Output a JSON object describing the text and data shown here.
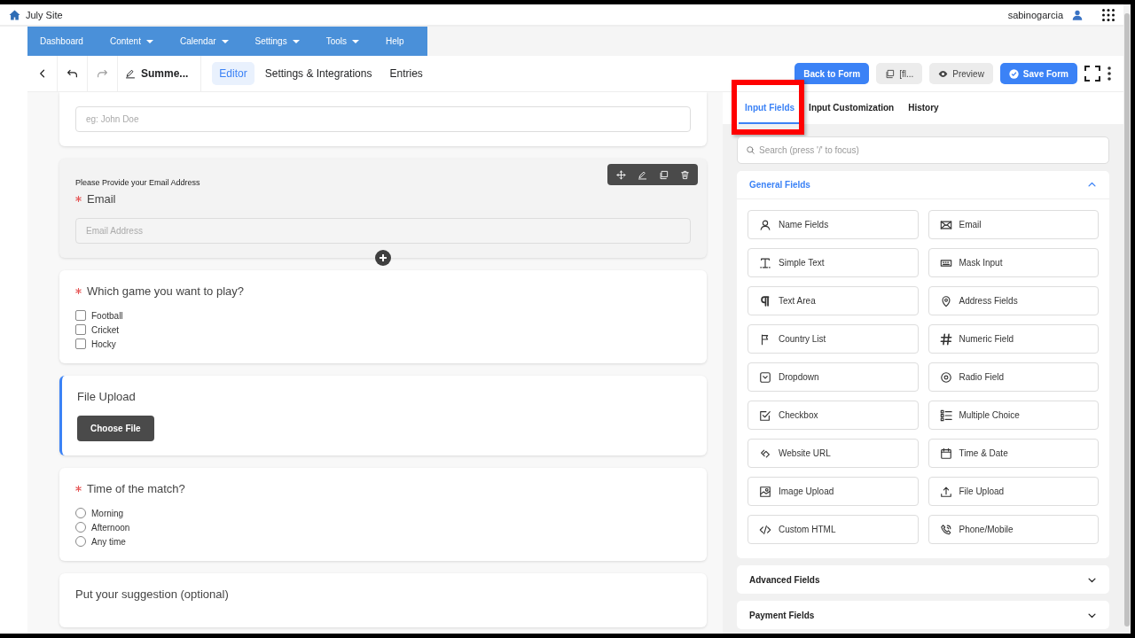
{
  "site": {
    "title": "July Site",
    "user": "sabinogarcia"
  },
  "nav": [
    {
      "label": "Dashboard",
      "dropdown": false
    },
    {
      "label": "Content",
      "dropdown": true
    },
    {
      "label": "Calendar",
      "dropdown": true
    },
    {
      "label": "Settings",
      "dropdown": true
    },
    {
      "label": "Tools",
      "dropdown": true
    },
    {
      "label": "Help",
      "dropdown": false
    }
  ],
  "toolbar": {
    "form_name": "Summe...",
    "tabs": [
      {
        "label": "Editor",
        "selected": true
      },
      {
        "label": "Settings & Integrations",
        "selected": false
      },
      {
        "label": "Entries",
        "selected": false
      }
    ],
    "buttons": [
      {
        "label": "Back to Form",
        "kind": "primary"
      },
      {
        "label": "[fl...",
        "kind": "shortcode"
      },
      {
        "label": "Preview",
        "kind": "preview"
      },
      {
        "label": "Save Form",
        "kind": "save"
      }
    ]
  },
  "form_fields": [
    {
      "kind": "text",
      "placeholder": "eg: John Doe",
      "selected": false,
      "focused": false
    },
    {
      "kind": "email",
      "help_text": "Please Provide your Email Address",
      "label": "Email",
      "required": true,
      "placeholder": "Email Address",
      "selected": true,
      "focused": false
    },
    {
      "kind": "checkbox",
      "label": "Which game you want to play?",
      "required": true,
      "selected": false,
      "focused": false,
      "options": [
        {
          "label": "Football",
          "checked": false
        },
        {
          "label": "Cricket",
          "checked": false
        },
        {
          "label": "Hocky",
          "checked": false
        }
      ]
    },
    {
      "kind": "file",
      "label": "File Upload",
      "required": false,
      "button": "Choose File",
      "selected": false,
      "focused": true
    },
    {
      "kind": "radio",
      "label": "Time of the match?",
      "required": true,
      "selected": false,
      "focused": false,
      "options": [
        {
          "label": "Morning",
          "checked": false
        },
        {
          "label": "Afternoon",
          "checked": false
        },
        {
          "label": "Any time",
          "checked": false
        }
      ]
    },
    {
      "kind": "textarea",
      "label": "Put your suggestion (optional)",
      "required": false,
      "selected": false,
      "focused": false
    }
  ],
  "sidebar": {
    "tabs": [
      {
        "label": "Input Fields",
        "selected": true,
        "highlighted": true
      },
      {
        "label": "Input Customization",
        "selected": false,
        "highlighted": false
      },
      {
        "label": "History",
        "selected": false,
        "highlighted": false
      }
    ],
    "search": {
      "placeholder": "Search (press '/' to focus)"
    },
    "groups": [
      {
        "title": "General Fields",
        "expanded": true,
        "items": [
          "Name Fields",
          "Email",
          "Simple Text",
          "Mask Input",
          "Text Area",
          "Address Fields",
          "Country List",
          "Numeric Field",
          "Dropdown",
          "Radio Field",
          "Checkbox",
          "Multiple Choice",
          "Website URL",
          "Time & Date",
          "Image Upload",
          "File Upload",
          "Custom HTML",
          "Phone/Mobile"
        ]
      },
      {
        "title": "Advanced Fields",
        "expanded": false
      },
      {
        "title": "Payment Fields",
        "expanded": false
      }
    ]
  }
}
